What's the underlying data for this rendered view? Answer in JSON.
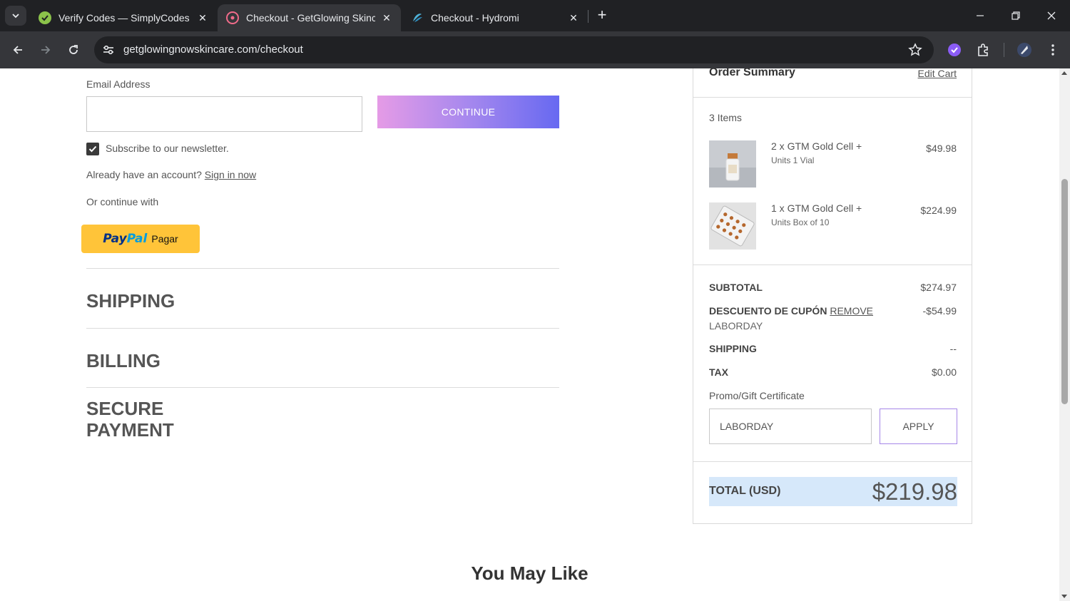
{
  "browser": {
    "tabs": [
      {
        "title": "Verify Codes — SimplyCodes",
        "icon": "simplycodes-icon",
        "active": false
      },
      {
        "title": "Checkout - GetGlowing Skincare",
        "icon": "getglowing-icon",
        "active": true
      },
      {
        "title": "Checkout - Hydromi",
        "icon": "hydromi-icon",
        "active": false
      }
    ],
    "url": "getglowingnowskincare.com/checkout"
  },
  "contact": {
    "email_label": "Email Address",
    "email_value": "",
    "continue_label": "CONTINUE",
    "newsletter_label": "Subscribe to our newsletter.",
    "newsletter_checked": true,
    "account_prompt": "Already have an account?",
    "signin_label": "Sign in now",
    "or_continue": "Or continue with",
    "paypal_word1": "Pay",
    "paypal_word2": "Pal",
    "paypal_pagar": "Pagar"
  },
  "sections": {
    "shipping": "SHIPPING",
    "billing": "BILLING",
    "payment_line1": "SECURE",
    "payment_line2": "PAYMENT"
  },
  "summary": {
    "title": "Order Summary",
    "edit_cart": "Edit Cart",
    "items_count": "3 Items",
    "items": [
      {
        "name": "2 x GTM Gold Cell +",
        "option": "Units 1 Vial",
        "price": "$49.98"
      },
      {
        "name": "1 x GTM Gold Cell +",
        "option": "Units Box of 10",
        "price": "$224.99"
      }
    ],
    "subtotal_label": "SUBTOTAL",
    "subtotal_value": "$274.97",
    "discount_label": "DESCUENTO DE CUPÓN",
    "discount_remove": "REMOVE",
    "discount_value": "-$54.99",
    "discount_code": "LABORDAY",
    "shipping_label": "SHIPPING",
    "shipping_value": "--",
    "tax_label": "TAX",
    "tax_value": "$0.00",
    "promo_label": "Promo/Gift Certificate",
    "promo_value": "LABORDAY",
    "apply_label": "APPLY",
    "total_label": "TOTAL (USD)",
    "total_value": "$219.98"
  },
  "you_may_like": "You May Like"
}
